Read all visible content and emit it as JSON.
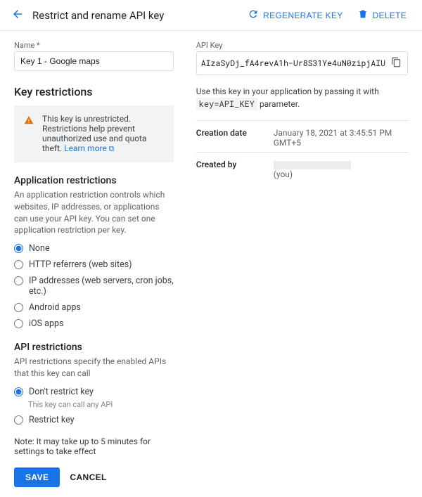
{
  "header": {
    "title": "Restrict and rename API key",
    "regenerate_label": "REGENERATE KEY",
    "delete_label": "DELETE"
  },
  "name_field": {
    "label": "Name",
    "required_mark": "*",
    "value": "Key 1 - Google maps"
  },
  "key_restrictions": {
    "heading": "Key restrictions",
    "warning_text": "This key is unrestricted. Restrictions help prevent unauthorized use and quota theft. ",
    "learn_more": "Learn more"
  },
  "app_restrictions": {
    "heading": "Application restrictions",
    "desc": "An application restriction controls which websites, IP addresses, or applications can use your API key. You can set one application restriction per key.",
    "options": {
      "none": "None",
      "http": "HTTP referrers (web sites)",
      "ip": "IP addresses (web servers, cron jobs, etc.)",
      "android": "Android apps",
      "ios": "iOS apps"
    },
    "selected": "none"
  },
  "api_restrictions": {
    "heading": "API restrictions",
    "desc": "API restrictions specify the enabled APIs that this key can call",
    "options": {
      "dont": "Don't restrict key",
      "dont_sub": "This key can call any API",
      "restrict": "Restrict key"
    },
    "selected": "dont"
  },
  "note": "Note: It may take up to 5 minutes for settings to take effect",
  "actions": {
    "save": "SAVE",
    "cancel": "CANCEL"
  },
  "right": {
    "apikey_label": "API Key",
    "apikey_value": "AIzaSyDj_fA4revA1h-Ur8S31Ye4uN0zipjAIU",
    "usage_prefix": "Use this key in your application by passing it with ",
    "usage_code": "key=API_KEY",
    "usage_suffix": " parameter.",
    "creation_label": "Creation date",
    "creation_value": "January 18, 2021 at 3:45:51 PM GMT+5",
    "createdby_label": "Created by",
    "createdby_suffix": "(you)"
  }
}
